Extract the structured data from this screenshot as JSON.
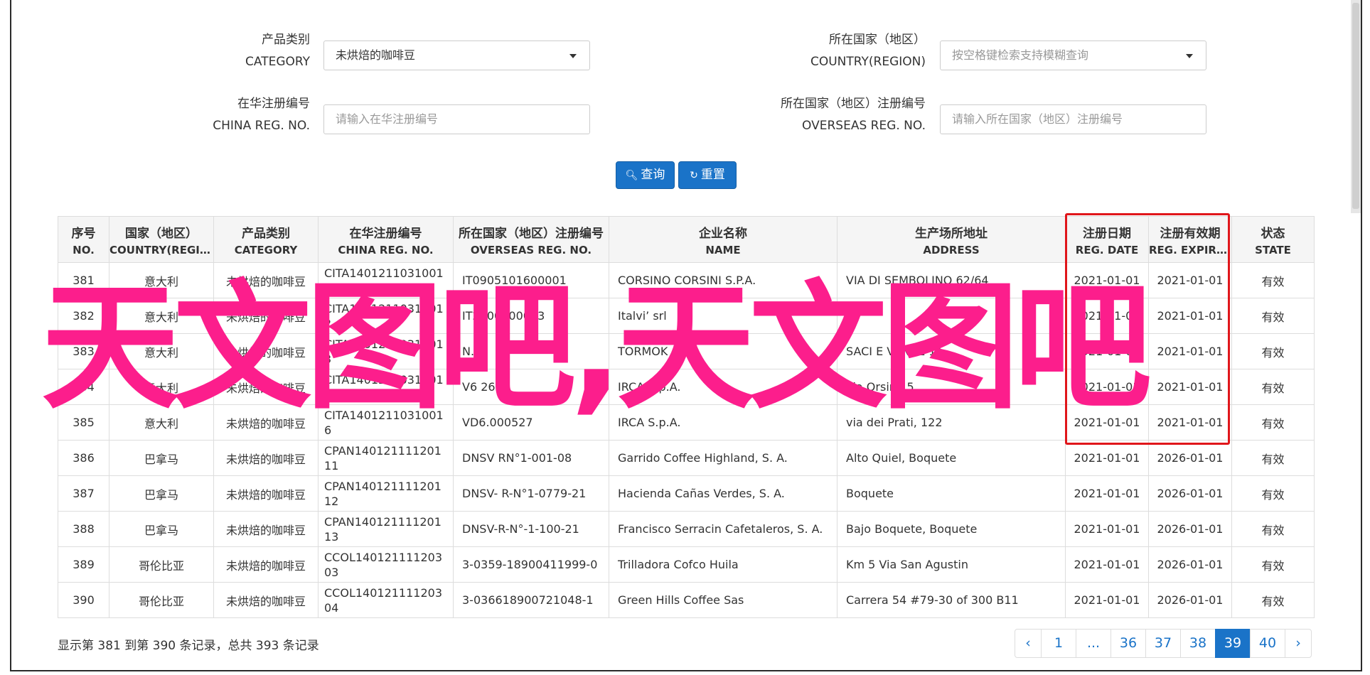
{
  "filters": {
    "category": {
      "label_cn": "产品类别",
      "label_en": "CATEGORY",
      "value": "未烘焙的咖啡豆"
    },
    "country": {
      "label_cn": "所在国家（地区）",
      "label_en": "COUNTRY(REGION)",
      "placeholder": "按空格键检索支持模糊查询"
    },
    "china_reg": {
      "label_cn": "在华注册编号",
      "label_en": "CHINA REG. NO.",
      "placeholder": "请输入在华注册编号"
    },
    "overseas_reg": {
      "label_cn": "所在国家（地区）注册编号",
      "label_en": "OVERSEAS REG. NO.",
      "placeholder": "请输入所在国家（地区）注册编号"
    },
    "search_label": "查询",
    "reset_label": "重置"
  },
  "table": {
    "columns": [
      {
        "cn": "序号",
        "en": "NO."
      },
      {
        "cn": "国家（地区）",
        "en": "COUNTRY(REGIO..."
      },
      {
        "cn": "产品类别",
        "en": "CATEGORY"
      },
      {
        "cn": "在华注册编号",
        "en": "CHINA REG. NO."
      },
      {
        "cn": "所在国家（地区）注册编号",
        "en": "OVERSEAS REG. NO."
      },
      {
        "cn": "企业名称",
        "en": "NAME"
      },
      {
        "cn": "生产场所地址",
        "en": "ADDRESS"
      },
      {
        "cn": "注册日期",
        "en": "REG. DATE"
      },
      {
        "cn": "注册有效期",
        "en": "REG. EXPIRE ..."
      },
      {
        "cn": "状态",
        "en": "STATE"
      }
    ],
    "rows": [
      [
        "381",
        "意大利",
        "未烘焙的咖啡豆",
        "CITA14012110310011",
        "IT0905101600001",
        "CORSINO CORSINI S.P.A.",
        "VIA DI SEMBOLINO 62/64",
        "2021-01-01",
        "2021-01-01",
        "有效"
      ],
      [
        "382",
        "意大利",
        "未烘焙的咖啡豆",
        "CITA14012110310012",
        "IT2000100013",
        "Italvi’ srl",
        "",
        "2021-01-01",
        "2021-01-01",
        "有效"
      ],
      [
        "383",
        "意大利",
        "未烘焙的咖啡豆",
        "CITA14012110310013",
        "N. 7",
        "TORMOK",
        "SACI E VANZE 11",
        "2021-01-01",
        "2021-01-01",
        "有效"
      ],
      [
        "384",
        "意大利",
        "未烘焙的咖啡豆",
        "CITA14012110310014",
        "V6 2697",
        "IRCA S.p.A.",
        "via Orsini, 5",
        "2021-01-01",
        "2021-01-01",
        "有效"
      ],
      [
        "385",
        "意大利",
        "未烘焙的咖啡豆",
        "CITA14012110310016",
        "VD6.000527",
        "IRCA S.p.A.",
        "via dei Prati, 122",
        "2021-01-01",
        "2021-01-01",
        "有效"
      ],
      [
        "386",
        "巴拿马",
        "未烘焙的咖啡豆",
        "CPAN14012111120111",
        "DNSV RN°1-001-08",
        "Garrido Coffee Highland, S. A.",
        "Alto Quiel, Boquete",
        "2021-01-01",
        "2026-01-01",
        "有效"
      ],
      [
        "387",
        "巴拿马",
        "未烘焙的咖啡豆",
        "CPAN14012111120112",
        "DNSV- R-N°1-0779-21",
        "Hacienda Cañas Verdes, S. A.",
        "Boquete",
        "2021-01-01",
        "2026-01-01",
        "有效"
      ],
      [
        "388",
        "巴拿马",
        "未烘焙的咖啡豆",
        "CPAN14012111120113",
        "DNSV-R-N°-1-100-21",
        "Francisco Serracin Cafetaleros, S. A.",
        "Bajo Boquete, Boquete",
        "2021-01-01",
        "2026-01-01",
        "有效"
      ],
      [
        "389",
        "哥伦比亚",
        "未烘焙的咖啡豆",
        "CCOL14012111120303",
        "3-0359-18900411999-0",
        "Trilladora Cofco Huila",
        "Km 5 Via San Agustin",
        "2021-01-01",
        "2026-01-01",
        "有效"
      ],
      [
        "390",
        "哥伦比亚",
        "未烘焙的咖啡豆",
        "CCOL14012111120304",
        "3-036618900721048-1",
        "Green Hills Coffee Sas",
        "Carrera 54 #79-30 of 300 B11",
        "2021-01-01",
        "2026-01-01",
        "有效"
      ]
    ]
  },
  "footer": {
    "summary": "显示第 381 到第 390 条记录，总共 393 条记录"
  },
  "pagination": {
    "prev": "‹",
    "next": "›",
    "pages": [
      "1",
      "...",
      "36",
      "37",
      "38",
      "39",
      "40"
    ],
    "active": "39"
  },
  "watermark": "天文图吧,天文图吧",
  "colors": {
    "accent": "#1a73c8",
    "highlight_box": "#e0161b",
    "watermark": "#fc1e8c"
  }
}
